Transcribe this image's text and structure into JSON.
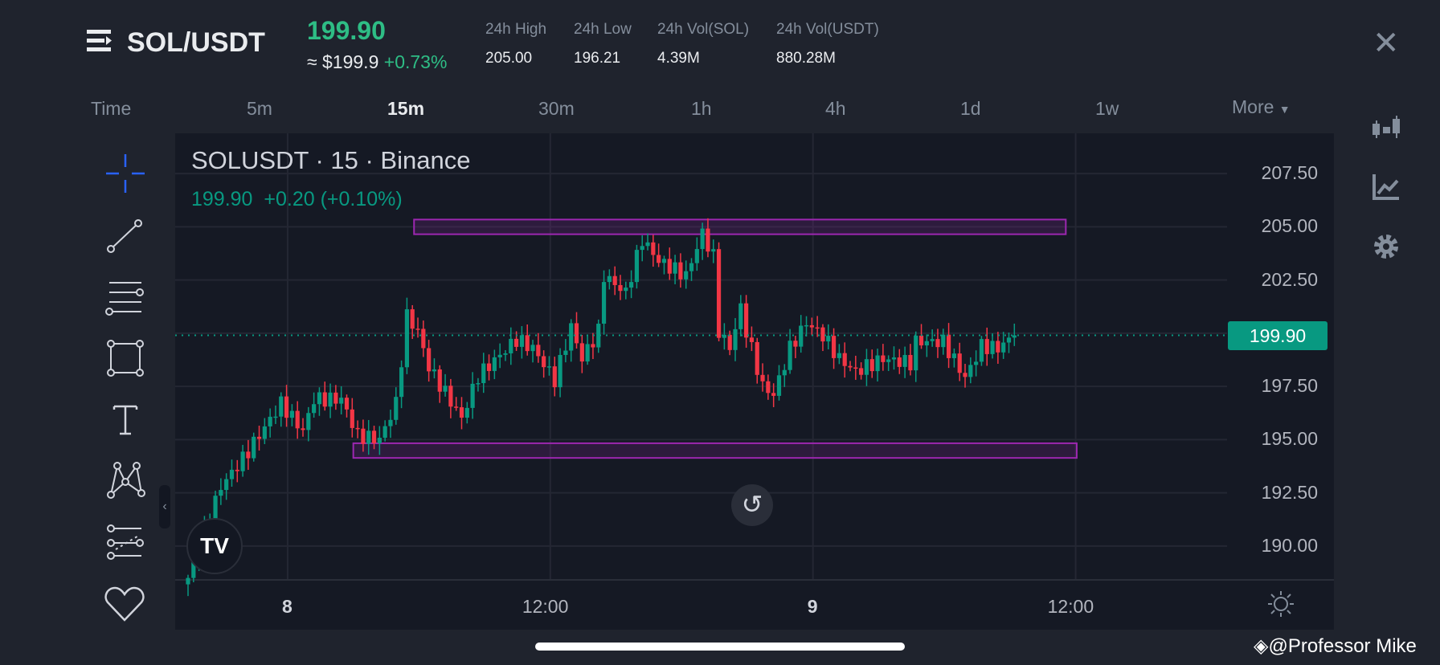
{
  "header": {
    "pair": "SOL/USDT",
    "last_price": "199.90",
    "approx_usd": "≈ $199.9",
    "change_pct": "+0.73%",
    "stats": [
      {
        "label": "24h High",
        "value": "205.00"
      },
      {
        "label": "24h Low",
        "value": "196.21"
      },
      {
        "label": "24h Vol(SOL)",
        "value": "4.39M"
      },
      {
        "label": "24h Vol(USDT)",
        "value": "880.28M"
      }
    ]
  },
  "timeframes": {
    "items": [
      "Time",
      "5m",
      "15m",
      "30m",
      "1h",
      "4h",
      "1d",
      "1w"
    ],
    "active": "15m",
    "more": "More"
  },
  "chart": {
    "symbol_line": "SOLUSDT · 15 · Binance",
    "last": "199.90",
    "change": "+0.20 (+0.10%)",
    "price_tag": "199.90"
  },
  "watermark": "@Professor Mike",
  "colors": {
    "up": "#089981",
    "down": "#f23645",
    "box": "#9c27b0",
    "accent": "#2ebd85"
  },
  "chart_data": {
    "type": "candlestick",
    "title": "SOLUSDT · 15 · Binance",
    "y_ticks": [
      "207.50",
      "205.00",
      "202.50",
      "200.00",
      "197.50",
      "195.00",
      "192.50",
      "190.00"
    ],
    "y_tick_values": [
      207.5,
      205,
      202.5,
      200,
      197.5,
      195,
      192.5,
      190
    ],
    "y_tick_labels": [
      "207.50",
      "205.00",
      "202.50",
      "",
      "197.50",
      "195.00",
      "192.50",
      "190.00"
    ],
    "ylim": [
      188.3,
      209.6
    ],
    "x_ticks": [
      {
        "label": "8",
        "bar": 18.2,
        "bold": true
      },
      {
        "label": "12:00",
        "bar": 66.2,
        "bold": false
      },
      {
        "label": "9",
        "bar": 114.2,
        "bold": true
      },
      {
        "label": "12:00",
        "bar": 162.2,
        "bold": false
      }
    ],
    "bar_count": 152,
    "close_keypoints": [
      [
        0,
        188.5
      ],
      [
        6,
        192.8
      ],
      [
        10,
        194.1
      ],
      [
        17,
        196.7
      ],
      [
        21,
        195.4
      ],
      [
        23,
        196.9
      ],
      [
        28,
        196.9
      ],
      [
        31,
        195.2
      ],
      [
        35,
        195.0
      ],
      [
        38,
        196.7
      ],
      [
        40,
        200.8
      ],
      [
        42,
        200.1
      ],
      [
        44,
        198.4
      ],
      [
        50,
        196.0
      ],
      [
        53,
        198.0
      ],
      [
        60,
        199.7
      ],
      [
        63,
        199.3
      ],
      [
        67,
        197.8
      ],
      [
        70,
        200.3
      ],
      [
        72,
        198.8
      ],
      [
        75,
        200.1
      ],
      [
        76,
        202.7
      ],
      [
        80,
        201.9
      ],
      [
        83,
        204.4
      ],
      [
        86,
        203.4
      ],
      [
        91,
        202.7
      ],
      [
        94,
        204.7
      ],
      [
        96,
        203.6
      ],
      [
        97,
        200.1
      ],
      [
        99,
        199.3
      ],
      [
        101,
        201.2
      ],
      [
        102,
        200.1
      ],
      [
        105,
        197.5
      ],
      [
        107,
        197.1
      ],
      [
        110,
        199.3
      ],
      [
        113,
        200.5
      ],
      [
        116,
        199.9
      ],
      [
        119,
        198.8
      ],
      [
        122,
        198.2
      ],
      [
        127,
        198.8
      ],
      [
        132,
        198.6
      ],
      [
        133,
        199.6
      ],
      [
        138,
        199.6
      ],
      [
        142,
        197.9
      ],
      [
        145,
        199.4
      ],
      [
        148,
        199.3
      ],
      [
        151,
        199.9
      ]
    ],
    "last_price": 199.9,
    "boxes": [
      {
        "from_bar": 41.3,
        "to_bar": 160.4,
        "top": 205.34,
        "bottom": 204.65
      },
      {
        "from_bar": 30.2,
        "to_bar": 162.4,
        "top": 194.83,
        "bottom": 194.14
      }
    ]
  }
}
